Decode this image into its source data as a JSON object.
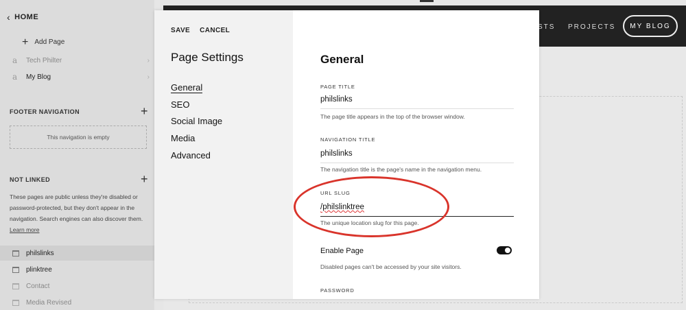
{
  "sidebar": {
    "home_label": "HOME",
    "add_page_label": "Add Page",
    "nav_items": [
      {
        "label": "Tech Philter",
        "icon": "page-a-icon"
      },
      {
        "label": "My Blog",
        "icon": "page-a-icon"
      }
    ],
    "footer_nav_title": "FOOTER NAVIGATION",
    "footer_empty_text": "This navigation is empty",
    "not_linked_title": "NOT LINKED",
    "not_linked_desc": "These pages are public unless they're disabled or password-protected, but they don't appear in the navigation. Search engines can also discover them.",
    "learn_more": "Learn more",
    "pages": [
      {
        "label": "philslinks",
        "active": true
      },
      {
        "label": "plinktree"
      },
      {
        "label": "Contact"
      },
      {
        "label": "Media Revised"
      }
    ]
  },
  "site": {
    "nav_partial": "STS",
    "nav_projects": "PROJECTS",
    "nav_button": "MY BLOG"
  },
  "modal": {
    "save_label": "SAVE",
    "cancel_label": "CANCEL",
    "title": "Page Settings",
    "menu": [
      "General",
      "SEO",
      "Social Image",
      "Media",
      "Advanced"
    ],
    "section_title": "General",
    "page_title_label": "PAGE TITLE",
    "page_title_value": "philslinks",
    "page_title_help": "The page title appears in the top of the browser window.",
    "nav_title_label": "NAVIGATION TITLE",
    "nav_title_value": "philslinks",
    "nav_title_help": "The navigation title is the page's name in the navigation menu.",
    "url_slug_label": "URL SLUG",
    "url_slug_value": "/philslinktree",
    "url_slug_help": "The unique location slug for this page.",
    "enable_label": "Enable Page",
    "enable_value": true,
    "enable_help": "Disabled pages can't be accessed by your site visitors.",
    "password_label": "PASSWORD"
  },
  "colors": {
    "annotation": "#d9342b",
    "site_header": "#222222",
    "modal_sidebar": "#f2f2f2"
  }
}
